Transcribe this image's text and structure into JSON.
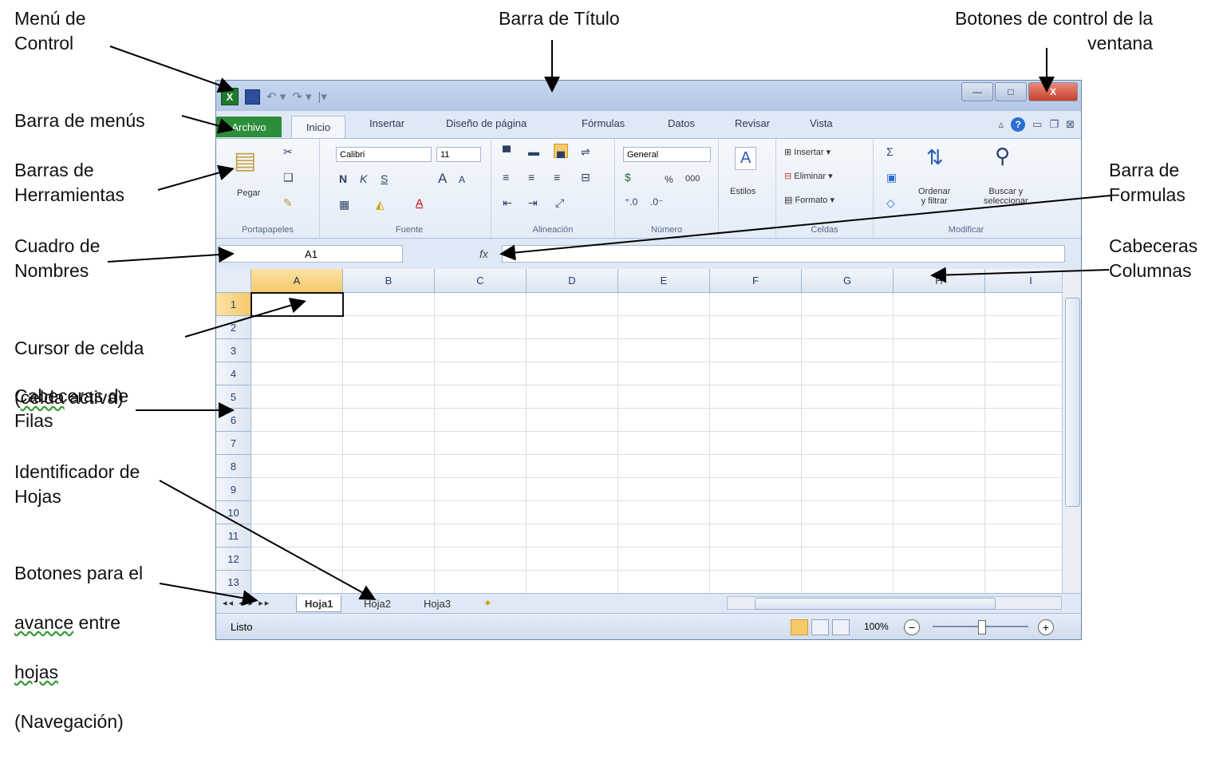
{
  "annotations": {
    "menu_control": "Menú de\nControl",
    "title_bar": "Barra de Título",
    "window_controls": "Botones de control de la\nventana",
    "menu_bar": "Barra de menús",
    "toolbars": "Barras de\nHerramientas",
    "formula_bar": "Barra de\nFormulas",
    "name_box": "Cuadro de\nNombres",
    "column_headers": "Cabeceras\nColumnas",
    "cell_cursor_l1": "Cursor de celda",
    "cell_cursor_open": "(",
    "cell_cursor_word": "celda",
    "cell_cursor_rest": " activa)",
    "row_headers": "Cabeceras de\nFilas",
    "sheet_identifier": "Identificador de\nHojas",
    "nav_l1": "Botones  para el",
    "nav_word1": "avance",
    "nav_mid": " entre",
    "nav_word2": "hojas",
    "nav_l4": "(Navegación)"
  },
  "excel": {
    "app_icon": "X",
    "quick_access": [
      "save-icon",
      "undo-icon",
      "redo-icon",
      "customize-icon"
    ],
    "window_buttons": {
      "minimize": "—",
      "maximize": "□",
      "close": "X"
    },
    "tabs": {
      "file": "Archivo",
      "home": "Inicio",
      "others": [
        "Insertar",
        "Diseño de página",
        "Fórmulas",
        "Datos",
        "Revisar",
        "Vista"
      ]
    },
    "help": "?",
    "ribbon": {
      "clipboard": {
        "label": "Portapapeles",
        "paste": "Pegar"
      },
      "font": {
        "label": "Fuente",
        "font_name": "Calibri",
        "font_size": "11",
        "bold": "N",
        "italic": "K",
        "underline": "S",
        "grow": "A",
        "shrink": "A",
        "font_color": "A"
      },
      "alignment": {
        "label": "Alineación"
      },
      "number": {
        "label": "Número",
        "format": "General",
        "percent": "%",
        "thousands": "000"
      },
      "styles": {
        "label": "Estilos"
      },
      "cells": {
        "label": "Celdas",
        "insert": "Insertar",
        "delete": "Eliminar",
        "format": "Formato"
      },
      "editing": {
        "label": "Modificar",
        "sum": "Σ",
        "sort": "Ordenar\ny filtrar",
        "find": "Buscar y\nseleccionar"
      }
    },
    "name_box": "A1",
    "fx": "fx",
    "formula_value": "",
    "columns": [
      "A",
      "B",
      "C",
      "D",
      "E",
      "F",
      "G",
      "H",
      "I"
    ],
    "rows": [
      "1",
      "2",
      "3",
      "4",
      "5",
      "6",
      "7",
      "8",
      "9",
      "10",
      "11",
      "12",
      "13"
    ],
    "active_cell": "A1",
    "sheet_nav": "◂◂ ◂ ▸ ▸▸",
    "sheets": [
      "Hoja1",
      "Hoja2",
      "Hoja3"
    ],
    "active_sheet": "Hoja1",
    "status": "Listo",
    "zoom": "100%",
    "zoom_minus": "−",
    "zoom_plus": "+"
  }
}
